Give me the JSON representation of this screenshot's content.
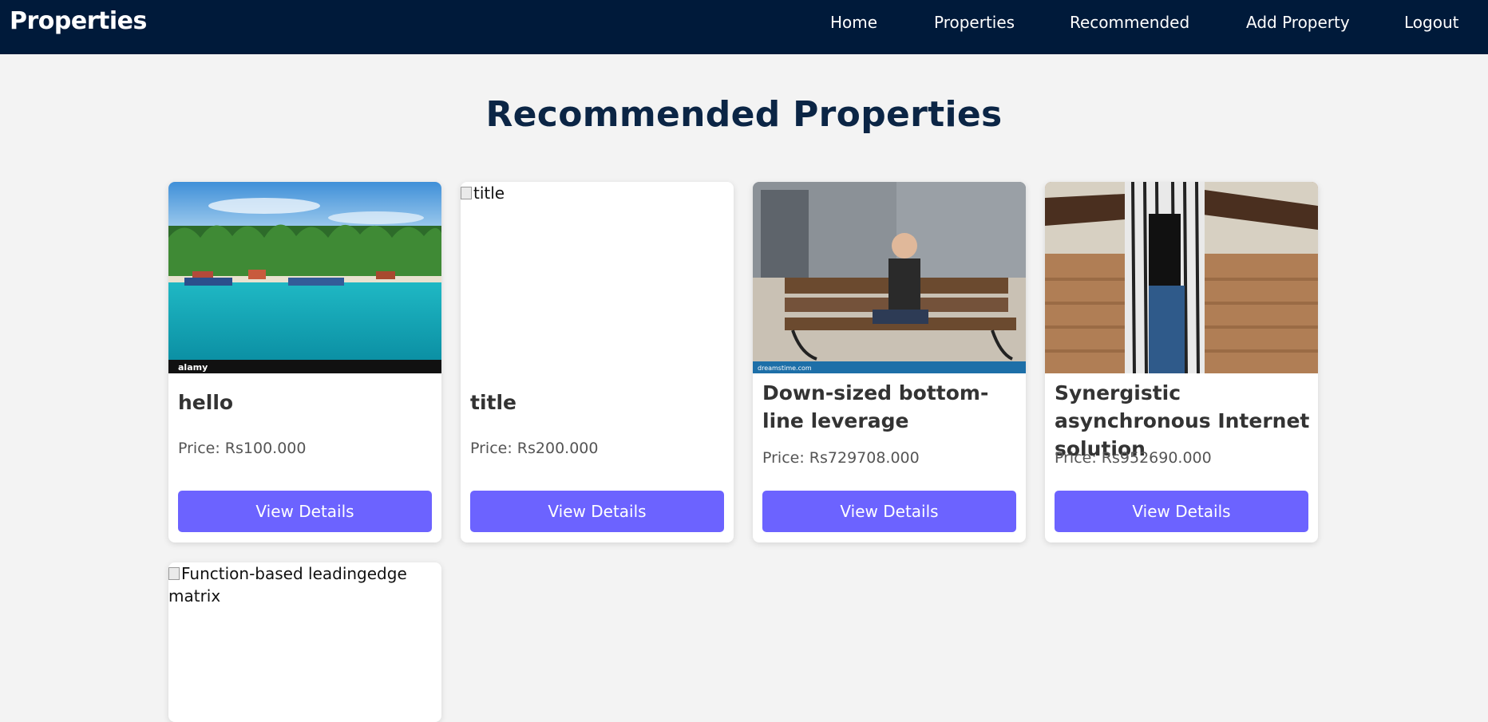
{
  "navbar": {
    "brand": "Properties",
    "links": [
      "Home",
      "Properties",
      "Recommended",
      "Add Property",
      "Logout"
    ]
  },
  "page": {
    "title": "Recommended Properties"
  },
  "properties": [
    {
      "title": "hello",
      "price": "Price: Rs100.000",
      "button": "View Details",
      "image_alt": "",
      "image_text": "alamy"
    },
    {
      "title": "title",
      "price": "Price: Rs200.000",
      "button": "View Details",
      "image_alt": "title"
    },
    {
      "title": "Down-sized bottom-line leverage",
      "price": "Price: Rs729708.000",
      "button": "View Details",
      "image_alt": "",
      "image_text": "dreamstime.com"
    },
    {
      "title": "Synergistic asynchronous Internet solution",
      "price": "Price: Rs952690.000",
      "button": "View Details",
      "image_alt": ""
    },
    {
      "title": "",
      "price": "",
      "button": "",
      "image_alt": "Function-based leadingedge matrix"
    }
  ],
  "colors": {
    "navbar_bg": "#001a3a",
    "title_color": "#0b2545",
    "button_bg": "#6c63ff",
    "page_bg": "#f3f3f3"
  }
}
